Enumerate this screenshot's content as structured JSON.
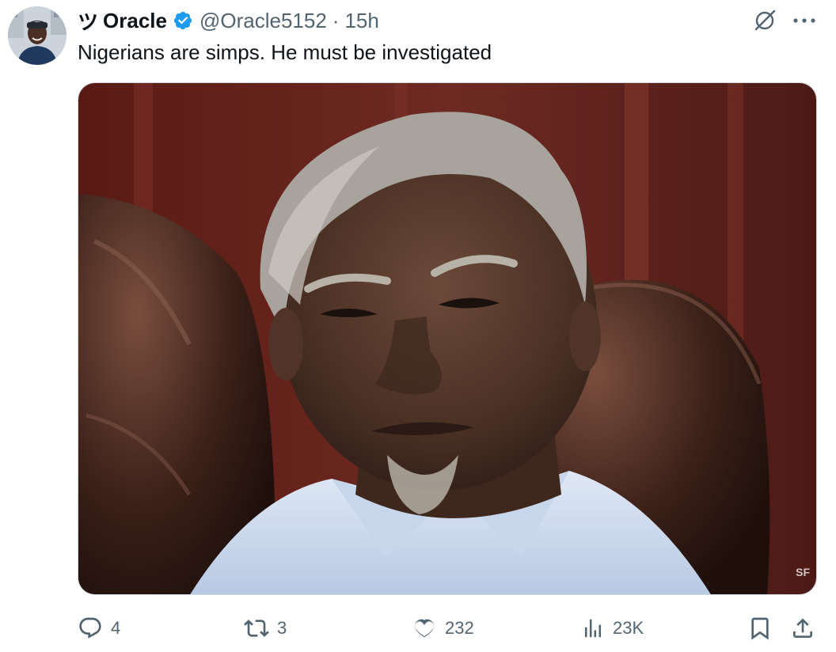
{
  "author": {
    "prefix": "ツ",
    "display_name": "Oracle",
    "handle": "@Oracle5152",
    "separator": "·",
    "time": "15h",
    "verified": true
  },
  "tweet": {
    "text": "Nigerians are simps. He must be investigated"
  },
  "media": {
    "alt": "Photo of an elderly man with gray hair in a light blue shirt sitting in a dark leather chair",
    "watermark": "SF"
  },
  "actions": {
    "replies": "4",
    "reposts": "3",
    "likes": "232",
    "views": "23K"
  },
  "colors": {
    "text": "#0f1419",
    "secondary": "#536471",
    "verified": "#1d9bf0",
    "border": "#cfd9de"
  },
  "icons": [
    "verified-badge-icon",
    "grok-icon",
    "more-icon",
    "reply-icon",
    "repost-icon",
    "like-icon",
    "views-icon",
    "bookmark-icon",
    "share-icon"
  ]
}
